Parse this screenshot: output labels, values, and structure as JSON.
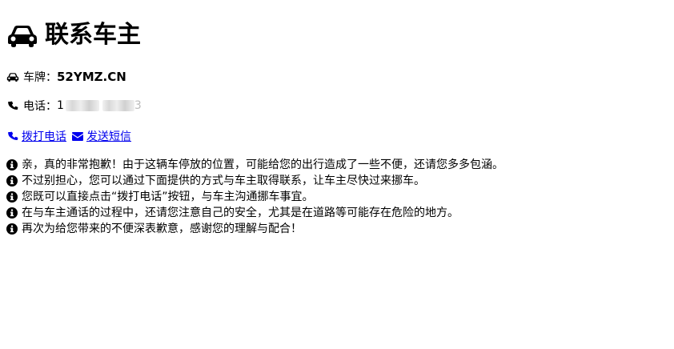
{
  "header": {
    "title": "联系车主",
    "icon": "car-icon"
  },
  "plate": {
    "label": "车牌：",
    "value": "52YMZ.CN",
    "icon": "car-icon"
  },
  "phone": {
    "label": "电话：",
    "prefix": "1",
    "suffix": "3",
    "icon": "phone-icon"
  },
  "actions": {
    "call_label": " 拨打电话",
    "sms_label": " 发送短信",
    "call_icon": "phone-icon",
    "sms_icon": "envelope-icon",
    "link_color": "#0000ee"
  },
  "notes": [
    "亲，真的非常抱歉！由于这辆车停放的位置，可能给您的出行造成了一些不便，还请您多多包涵。",
    "不过别担心，您可以通过下面提供的方式与车主取得联系，让车主尽快过来挪车。",
    "您既可以直接点击“拨打电话”按钮，与车主沟通挪车事宜。",
    "在与车主通话的过程中，还请您注意自己的安全，尤其是在道路等可能存在危险的地方。",
    "再次为给您带来的不便深表歉意，感谢您的理解与配合！"
  ]
}
